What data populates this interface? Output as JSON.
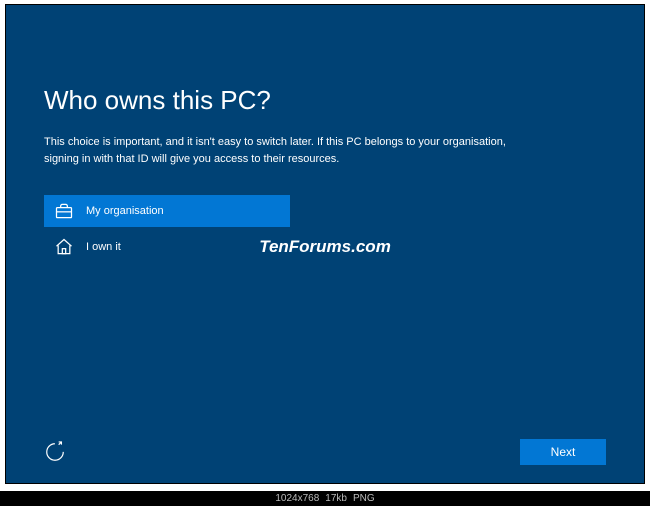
{
  "title": "Who owns this PC?",
  "description": "This choice is important, and it isn't easy to switch later. If this PC belongs to your organisation, signing in with that ID will give you access to their resources.",
  "options": [
    {
      "label": "My organisation",
      "icon": "briefcase",
      "selected": true
    },
    {
      "label": "I own it",
      "icon": "home",
      "selected": false
    }
  ],
  "watermark": "TenForums.com",
  "next_button": "Next",
  "status": {
    "dimensions": "1024x768",
    "filesize": "17kb",
    "format": "PNG"
  }
}
